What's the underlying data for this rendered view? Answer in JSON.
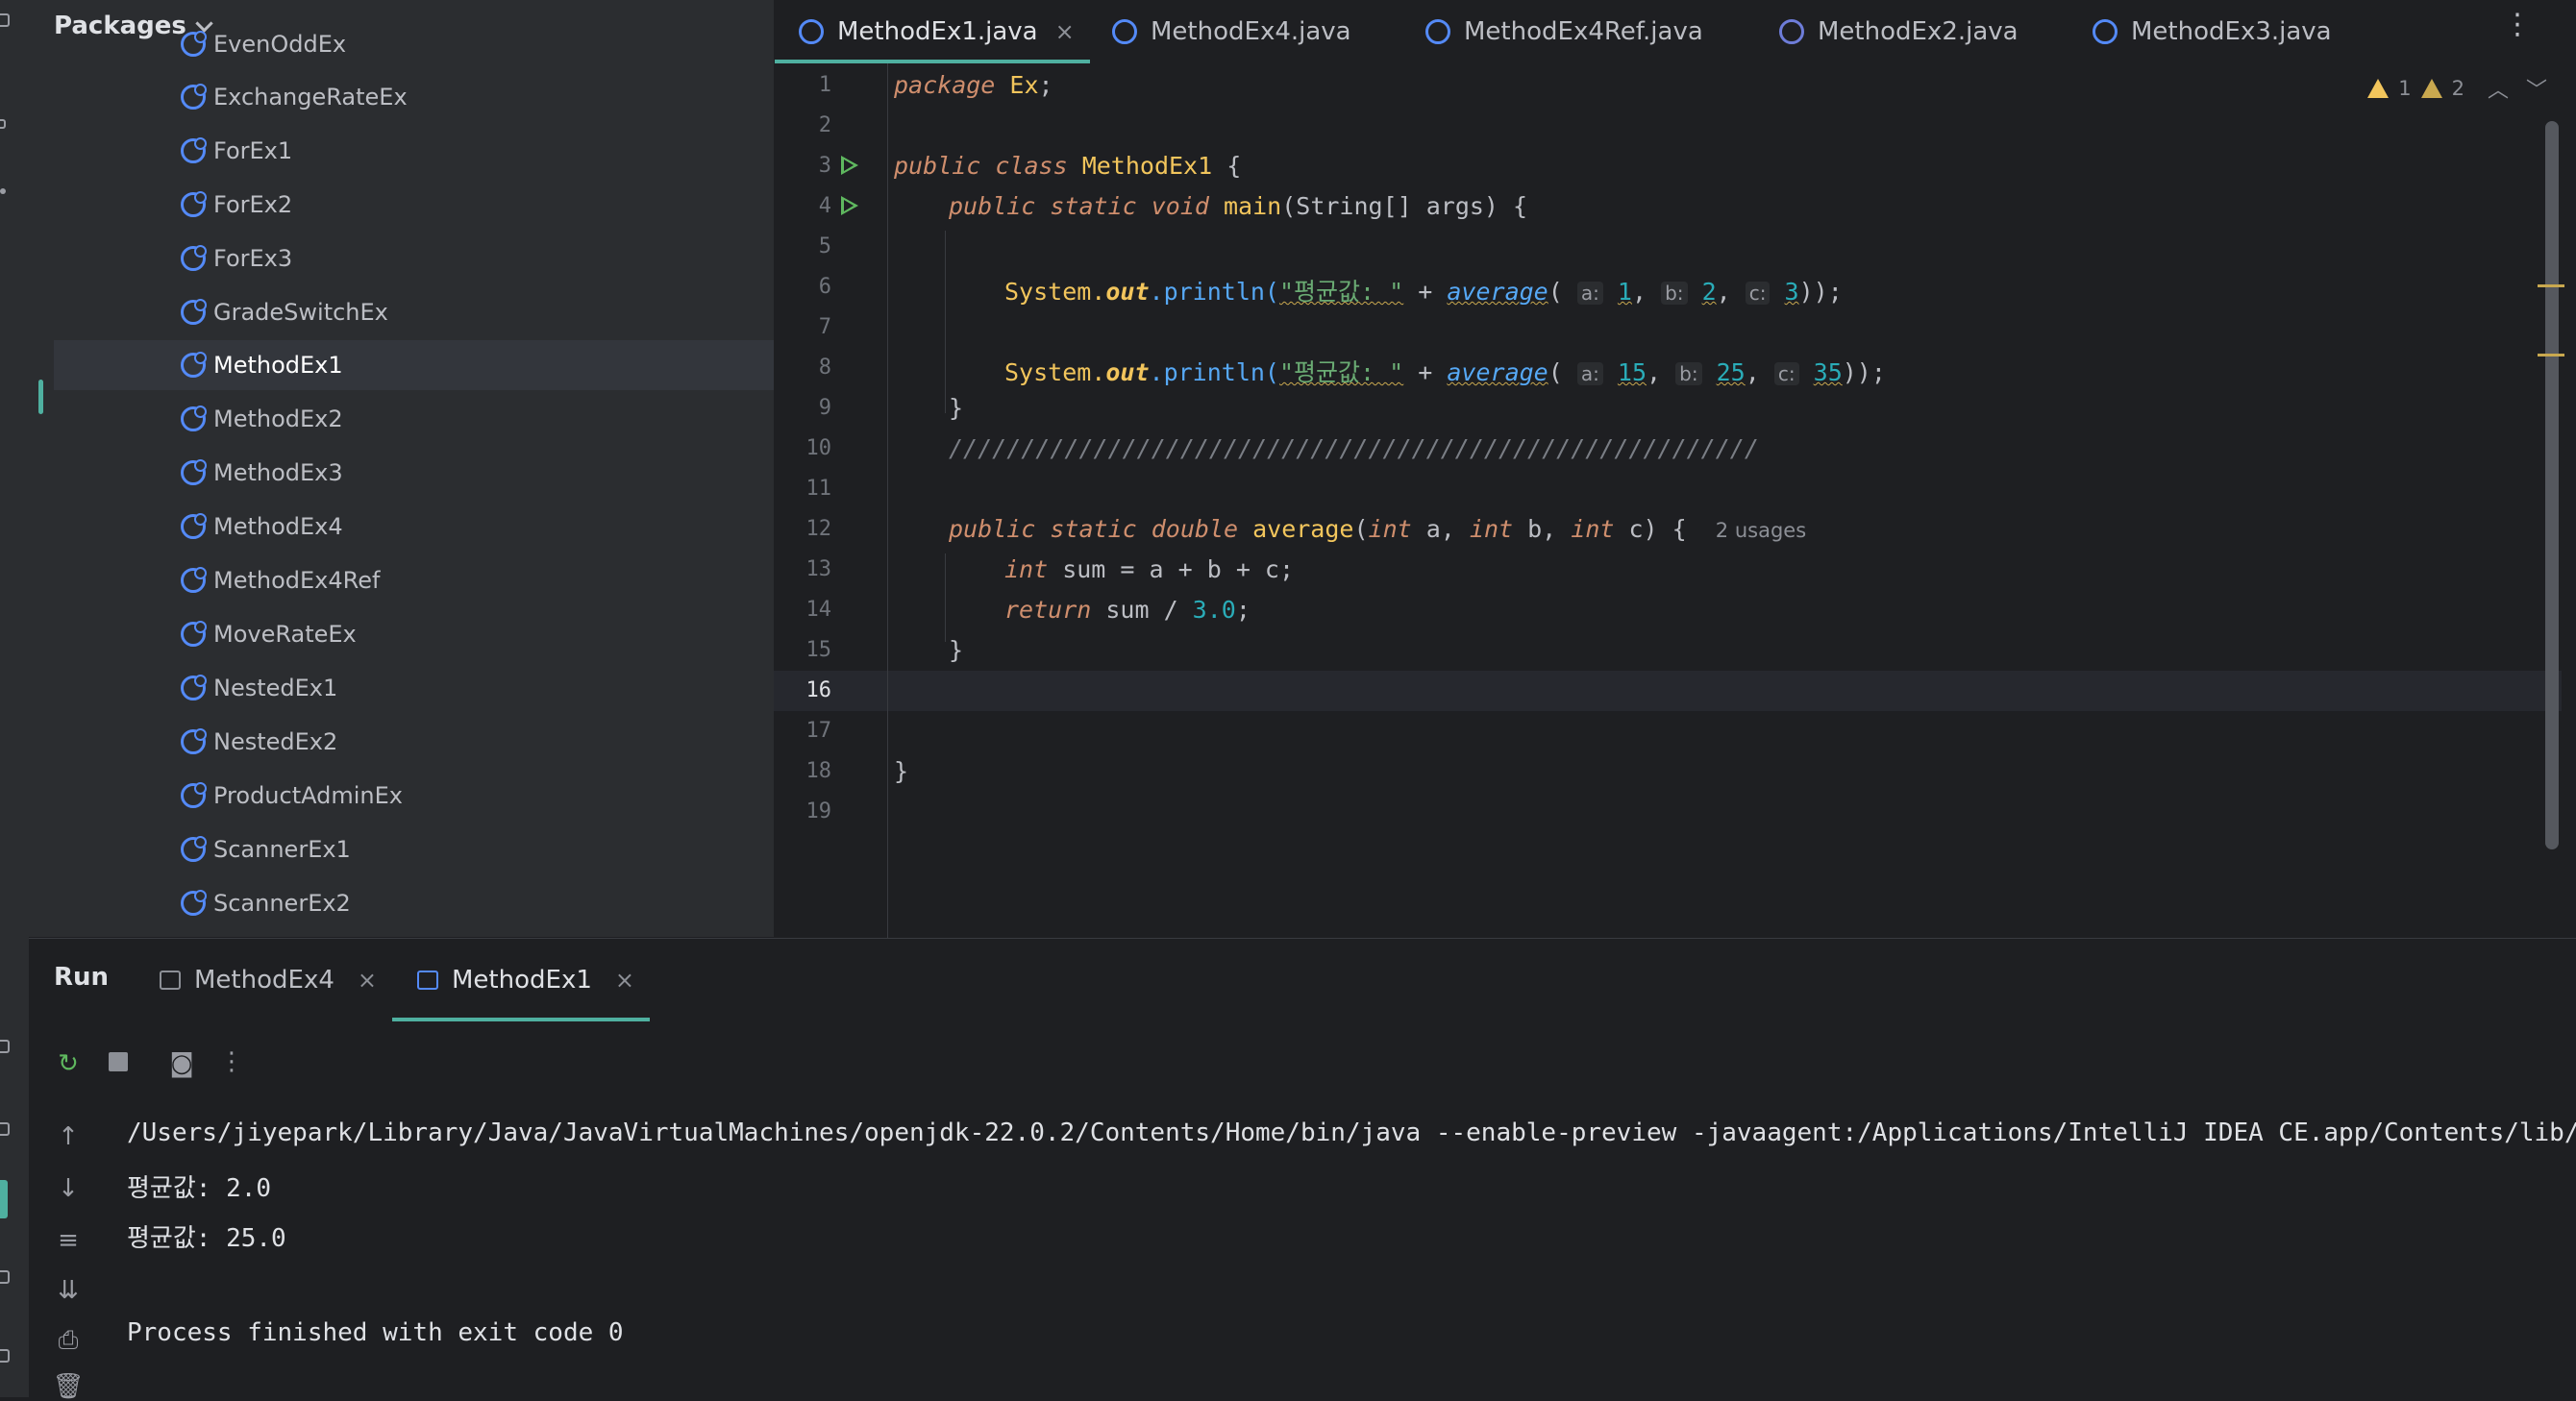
{
  "project_panel": {
    "title": "Packages",
    "items": [
      {
        "label": "EvenOddEx"
      },
      {
        "label": "ExchangeRateEx"
      },
      {
        "label": "ForEx1"
      },
      {
        "label": "ForEx2"
      },
      {
        "label": "ForEx3"
      },
      {
        "label": "GradeSwitchEx"
      },
      {
        "label": "MethodEx1",
        "selected": true
      },
      {
        "label": "MethodEx2"
      },
      {
        "label": "MethodEx3"
      },
      {
        "label": "MethodEx4"
      },
      {
        "label": "MethodEx4Ref"
      },
      {
        "label": "MoveRateEx"
      },
      {
        "label": "NestedEx1"
      },
      {
        "label": "NestedEx2"
      },
      {
        "label": "ProductAdminEx"
      },
      {
        "label": "ScannerEx1"
      },
      {
        "label": "ScannerEx2"
      }
    ]
  },
  "editor": {
    "tabs": [
      {
        "label": "MethodEx1.java",
        "active": true,
        "close": "×"
      },
      {
        "label": "MethodEx4.java"
      },
      {
        "label": "MethodEx4Ref.java"
      },
      {
        "label": "MethodEx2.java"
      },
      {
        "label": "MethodEx3.java"
      }
    ],
    "more_icon": "⋮",
    "warnings": {
      "strong": "1",
      "weak": "2"
    },
    "current_line": 16,
    "line_numbers": [
      "1",
      "2",
      "3",
      "4",
      "5",
      "6",
      "7",
      "8",
      "9",
      "10",
      "11",
      "12",
      "13",
      "14",
      "15",
      "16",
      "17",
      "18",
      "19"
    ],
    "code": {
      "l1_kw": "package",
      "l1_name": "Ex",
      "l1_end": ";",
      "l3_a": "public class",
      "l3_cls": "MethodEx1",
      "l3_end": " {",
      "l4_a": "public static void",
      "l4_fn": "main",
      "l4_b": "(String[] args) {",
      "l6_a": "System.",
      "l6_out": "out",
      "l6_b": ".println(",
      "l6_str": "\"평균값: \"",
      "l6_plus": " + ",
      "l6_fn": "average",
      "l6_open": "(",
      "l6_ha": "a:",
      "l6_va": "1",
      "l6_hb": "b:",
      "l6_vb": "2",
      "l6_hc": "c:",
      "l6_vc": "3",
      "l6_end": "));",
      "l8_ha": "a:",
      "l8_va": "15",
      "l8_hb": "b:",
      "l8_vb": "25",
      "l8_hc": "c:",
      "l8_vc": "35",
      "l9": "}",
      "l10": "////////////////////////////////////////////////////////",
      "l12_a": "public static double",
      "l12_fn": "average",
      "l12_b": "(",
      "l12_t1": "int",
      "l12_p1": " a, ",
      "l12_t2": "int",
      "l12_p2": " b, ",
      "l12_t3": "int",
      "l12_p3": " c) {",
      "l12_usages": "2 usages",
      "l13_t": "int",
      "l13_b": " sum = a + b + c;",
      "l14_kw": "return",
      "l14_b": " sum / ",
      "l14_num": "3.0",
      "l14_end": ";",
      "l15": "}",
      "l18": "}"
    }
  },
  "run_panel": {
    "title": "Run",
    "tabs": [
      {
        "label": "MethodEx4",
        "close": "×"
      },
      {
        "label": "MethodEx1",
        "close": "×",
        "active": true
      }
    ],
    "console": [
      "/Users/jiyepark/Library/Java/JavaVirtualMachines/openjdk-22.0.2/Contents/Home/bin/java --enable-preview -javaagent:/Applications/IntelliJ IDEA CE.app/Contents/lib/",
      "평균값: 2.0",
      "평균값: 25.0",
      "",
      "Process finished with exit code 0"
    ]
  },
  "colors": {
    "accent": "#4fb0a0",
    "keyword": "#cf8e6d",
    "string": "#6aab73",
    "number": "#2aacb8",
    "function": "#56a8f5",
    "class_icon": "#548af7"
  }
}
